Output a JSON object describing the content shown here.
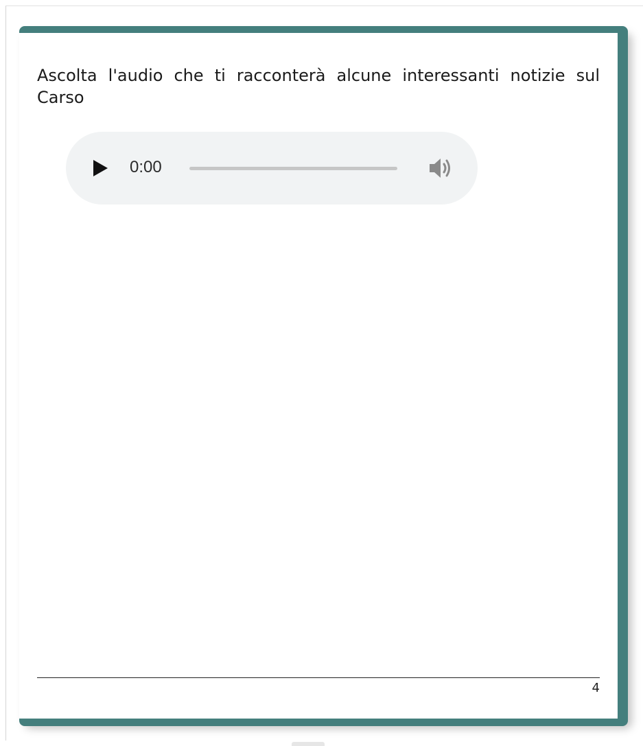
{
  "content": {
    "intro_text": "Ascolta l'audio che ti racconterà alcune interessanti notizie sul Carso"
  },
  "audio_player": {
    "current_time": "0:00",
    "progress": 0,
    "play_icon": "play-icon",
    "volume_icon": "volume-icon"
  },
  "footer": {
    "page_number": "4"
  },
  "colors": {
    "frame": "#447f7d",
    "player_background": "#f1f3f4"
  }
}
